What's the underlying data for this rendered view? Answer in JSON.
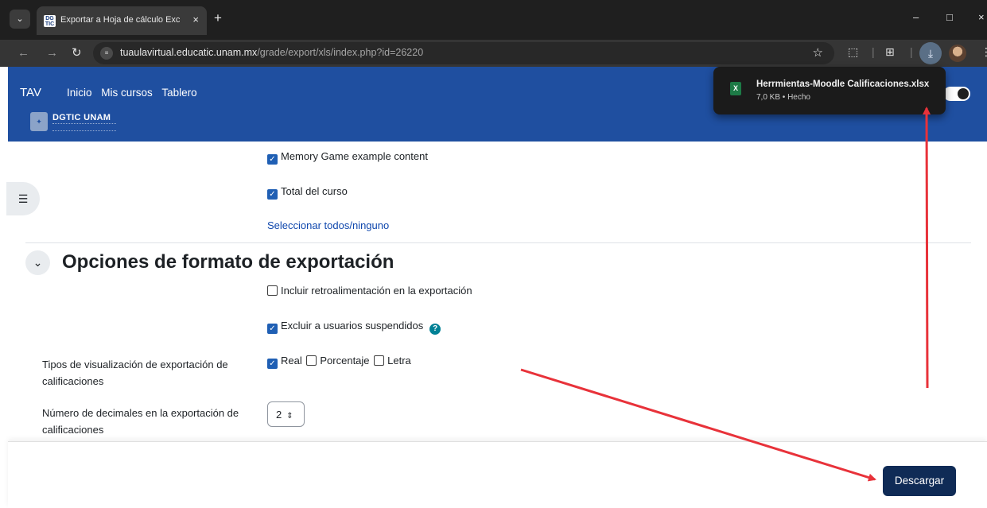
{
  "browser": {
    "tab_list_icon": "chevron-down-icon",
    "tab_favicon_text": "DG TIC",
    "tab_title": "Exportar a Hoja de cálculo Excel",
    "tab_close": "×",
    "new_tab": "+",
    "window_buttons": {
      "minimize": "–",
      "maximize": "□",
      "close": "×"
    },
    "url_domain": "tuaulavirtual.educatic.unam.mx",
    "url_path": "/grade/export/xls/index.php?id=26220",
    "colors": {
      "tabbar": "#1f1f1f",
      "toolbar": "#353535",
      "omnibox": "#282828"
    }
  },
  "moodle_header": {
    "brand": "TAV",
    "menu": [
      "Inicio",
      "Mis cursos",
      "Tablero"
    ],
    "logo_text": "DGTIC UNAM",
    "color": "#1f4fa0"
  },
  "download_popup": {
    "file_name": "Herrmientas-Moodle Calificaciones.xlsx",
    "meta": "7,0 KB • Hecho",
    "file_icon": "X"
  },
  "items_section": {
    "items": [
      {
        "label": "Memory Game example content",
        "checked": true
      },
      {
        "label": "Total del curso",
        "checked": true
      }
    ],
    "select_all_link": "Seleccionar todos/ninguno"
  },
  "export_options": {
    "title": "Opciones de formato de exportación",
    "include_feedback": {
      "label": "Incluir retroalimentación en la exportación",
      "checked": false
    },
    "exclude_suspended": {
      "label": "Excluir a usuarios suspendidos",
      "checked": true
    },
    "help_icon": "?",
    "display_types_label": "Tipos de visualización de exportación de calificaciones",
    "display_types": [
      {
        "label": "Real",
        "checked": true
      },
      {
        "label": "Porcentaje",
        "checked": false
      },
      {
        "label": "Letra",
        "checked": false
      }
    ],
    "decimals_label": "Número de decimales en la exportación de calificaciones",
    "decimals_value": "2"
  },
  "footer": {
    "download_button": "Descargar",
    "button_color": "#0f2b56"
  },
  "annotation_color": "#e8323a"
}
